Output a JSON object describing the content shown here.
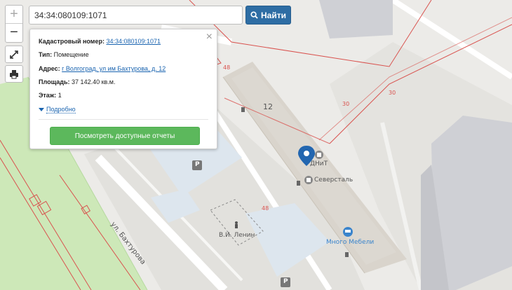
{
  "search": {
    "value": "34:34:080109:1071",
    "button_label": "Найти"
  },
  "popup": {
    "cadastral_label": "Кадастровый номер:",
    "cadastral_value": "34:34:080109:1071",
    "type_label": "Тип:",
    "type_value": "Помещение",
    "address_label": "Адрес:",
    "address_value": "г Волгоград, ул им Бахтурова, д. 12",
    "area_label": "Площадь:",
    "area_value": "37 142.40 кв.м.",
    "floor_label": "Этаж:",
    "floor_value": "1",
    "details_link": "Подробно",
    "reports_button": "Посмотреть доступные отчеты"
  },
  "map": {
    "labels": {
      "house_number": "12",
      "parcel_30_a": "30",
      "parcel_30_b": "30",
      "parcel_48_a": "48",
      "parcel_48_b": "48",
      "street": "ул. Бахтурова",
      "monument": "В.И. Ленин",
      "poi_dnit": "ДНиТ",
      "poi_severstal": "Северсталь",
      "poi_mnogo_mebeli": "Много Мебели",
      "parking_a": "P",
      "parking_b": "P"
    },
    "colors": {
      "background": "#ecebe8",
      "block": "#e2e1dd",
      "building": "#d9d4cc",
      "building_roof": "#dcd8d1",
      "blue_building": "#dde6ee",
      "grey_building": "#cfd0d5",
      "green": "#cde8b8",
      "boundary": "#d9534f",
      "marker": "#2266b0",
      "poi_blue": "#3a84cc"
    }
  }
}
